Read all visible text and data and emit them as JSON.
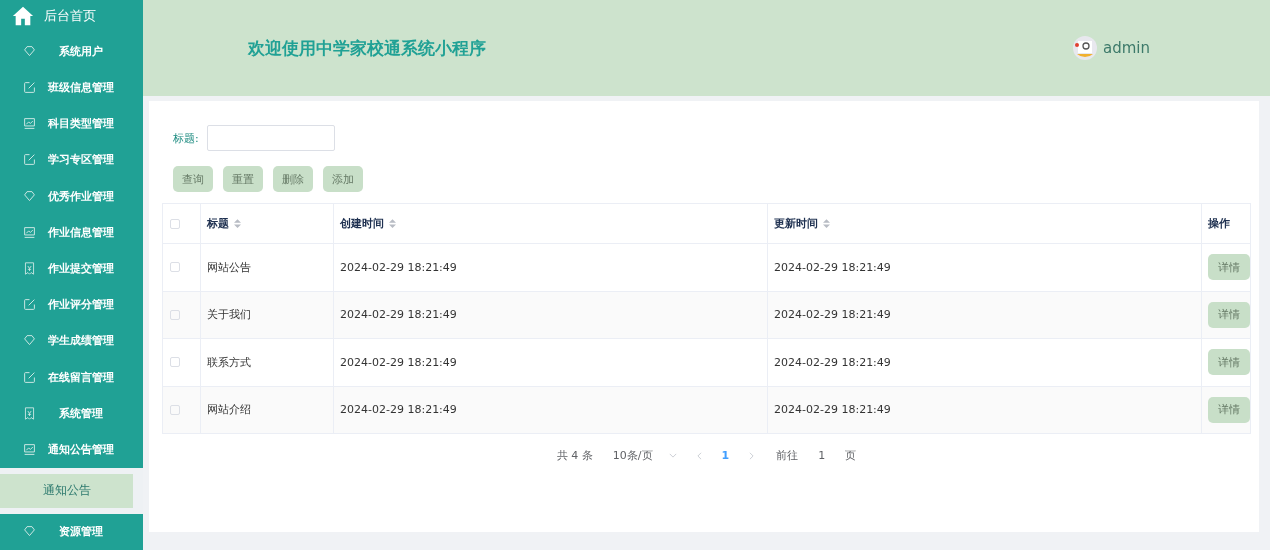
{
  "sidebar": {
    "home": {
      "label": "后台首页"
    },
    "items": [
      {
        "label": "系统用户",
        "kind": "diamond"
      },
      {
        "label": "班级信息管理",
        "kind": "edit"
      },
      {
        "label": "科目类型管理",
        "kind": "chart"
      },
      {
        "label": "学习专区管理",
        "kind": "edit"
      },
      {
        "label": "优秀作业管理",
        "kind": "diamond"
      },
      {
        "label": "作业信息管理",
        "kind": "chart"
      },
      {
        "label": "作业提交管理",
        "kind": "receipt"
      },
      {
        "label": "作业评分管理",
        "kind": "edit"
      },
      {
        "label": "学生成绩管理",
        "kind": "diamond"
      },
      {
        "label": "在线留言管理",
        "kind": "edit"
      },
      {
        "label": "系统管理",
        "kind": "receipt"
      },
      {
        "label": "通知公告管理",
        "kind": "chart",
        "children": [
          {
            "label": "通知公告",
            "selected": true
          }
        ]
      },
      {
        "label": "资源管理",
        "kind": "diamond"
      }
    ]
  },
  "header": {
    "title": "欢迎使用中学家校通系统小程序",
    "user": "admin"
  },
  "search": {
    "label": "标题:"
  },
  "buttons": [
    "查询",
    "重置",
    "删除",
    "添加"
  ],
  "table": {
    "columns": [
      {
        "label": "标题",
        "sortable": true
      },
      {
        "label": "创建时间",
        "sortable": true
      },
      {
        "label": "更新时间",
        "sortable": true
      },
      {
        "label": "操作",
        "sortable": false
      }
    ],
    "header_checked": false,
    "rows": [
      {
        "checked": false,
        "cells": [
          "网站公告",
          "2024-02-29 18:21:49",
          "2024-02-29 18:21:49"
        ],
        "action": "详情"
      },
      {
        "checked": false,
        "cells": [
          "关于我们",
          "2024-02-29 18:21:49",
          "2024-02-29 18:21:49"
        ],
        "action": "详情"
      },
      {
        "checked": false,
        "cells": [
          "联系方式",
          "2024-02-29 18:21:49",
          "2024-02-29 18:21:49"
        ],
        "action": "详情"
      },
      {
        "checked": false,
        "cells": [
          "网站介绍",
          "2024-02-29 18:21:49",
          "2024-02-29 18:21:49"
        ],
        "action": "详情"
      }
    ]
  },
  "pagination": {
    "total": "共 4 条",
    "page_size": "10条/页",
    "pages": [
      {
        "label": "1",
        "selected": true
      }
    ],
    "goto_label": "前往",
    "goto_value": "1",
    "goto_suffix": "页"
  }
}
